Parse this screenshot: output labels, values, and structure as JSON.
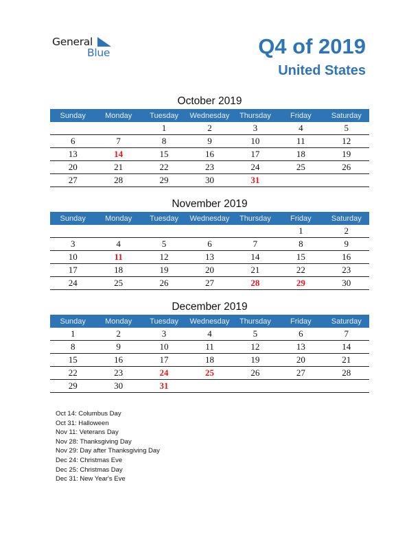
{
  "logo": {
    "line1": "General",
    "line2": "Blue"
  },
  "header": {
    "title": "Q4 of 2019",
    "subtitle": "United States"
  },
  "weekdays": [
    "Sunday",
    "Monday",
    "Tuesday",
    "Wednesday",
    "Thursday",
    "Friday",
    "Saturday"
  ],
  "months": [
    {
      "title": "October 2019",
      "weeks": [
        [
          "",
          "",
          "1",
          "2",
          "3",
          "4",
          "5"
        ],
        [
          "6",
          "7",
          "8",
          "9",
          "10",
          "11",
          "12"
        ],
        [
          "13",
          "14",
          "15",
          "16",
          "17",
          "18",
          "19"
        ],
        [
          "20",
          "21",
          "22",
          "23",
          "24",
          "25",
          "26"
        ],
        [
          "27",
          "28",
          "29",
          "30",
          "31",
          "",
          ""
        ]
      ],
      "holidays": [
        "14",
        "31"
      ]
    },
    {
      "title": "November 2019",
      "weeks": [
        [
          "",
          "",
          "",
          "",
          "",
          "1",
          "2"
        ],
        [
          "3",
          "4",
          "5",
          "6",
          "7",
          "8",
          "9"
        ],
        [
          "10",
          "11",
          "12",
          "13",
          "14",
          "15",
          "16"
        ],
        [
          "17",
          "18",
          "19",
          "20",
          "21",
          "22",
          "23"
        ],
        [
          "24",
          "25",
          "26",
          "27",
          "28",
          "29",
          "30"
        ]
      ],
      "holidays": [
        "11",
        "28",
        "29"
      ]
    },
    {
      "title": "December 2019",
      "weeks": [
        [
          "1",
          "2",
          "3",
          "4",
          "5",
          "6",
          "7"
        ],
        [
          "8",
          "9",
          "10",
          "11",
          "12",
          "13",
          "14"
        ],
        [
          "15",
          "16",
          "17",
          "18",
          "19",
          "20",
          "21"
        ],
        [
          "22",
          "23",
          "24",
          "25",
          "26",
          "27",
          "28"
        ],
        [
          "29",
          "30",
          "31",
          "",
          "",
          "",
          ""
        ]
      ],
      "holidays": [
        "24",
        "25",
        "31"
      ]
    }
  ],
  "holiday_list": [
    "Oct 14: Columbus Day",
    "Oct 31: Halloween",
    "Nov 11: Veterans Day",
    "Nov 28: Thanksgiving Day",
    "Nov 29: Day after Thanksgiving Day",
    "Dec 24: Christmas Eve",
    "Dec 25: Christmas Day",
    "Dec 31: New Year's Eve"
  ],
  "colors": {
    "accent": "#2e75b6",
    "holiday": "#e8141b"
  }
}
